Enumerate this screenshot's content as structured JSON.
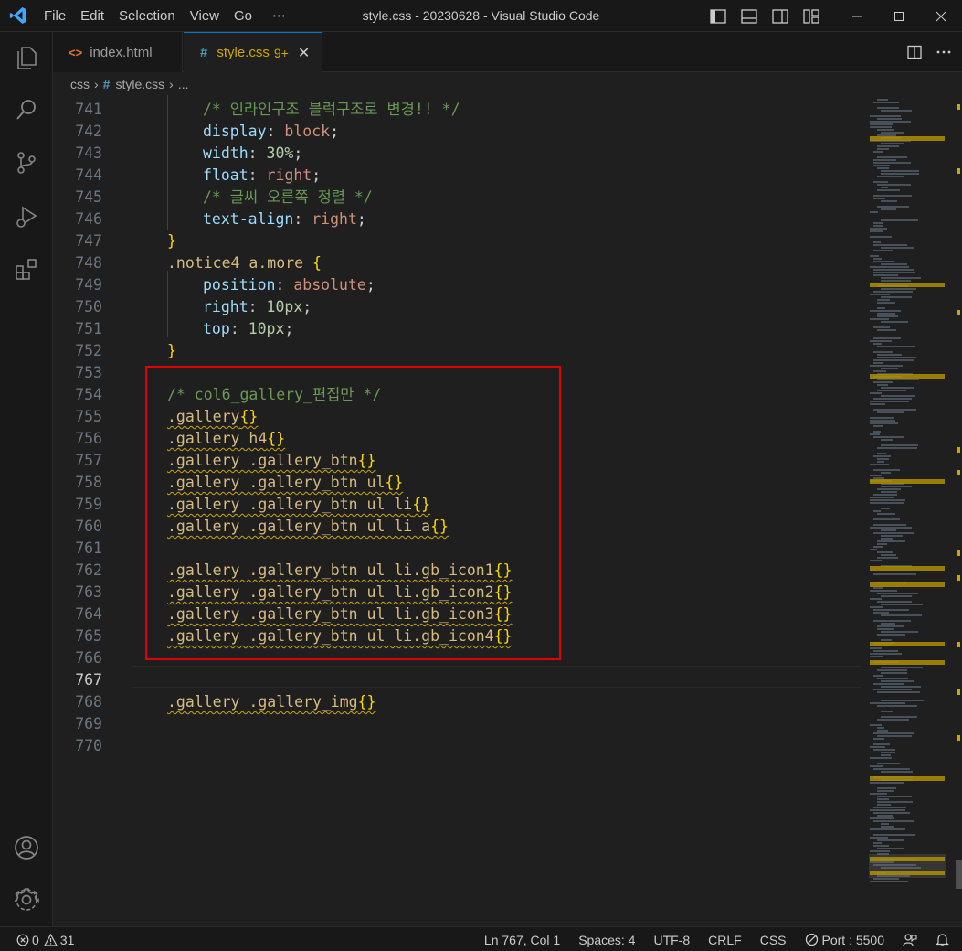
{
  "window": {
    "title": "style.css - 20230628 - Visual Studio Code",
    "menu": [
      "File",
      "Edit",
      "Selection",
      "View",
      "Go",
      "⋯"
    ]
  },
  "tabs": [
    {
      "label": "index.html",
      "icon": "html-file-icon",
      "active": false
    },
    {
      "label": "style.css",
      "icon": "css-file-icon",
      "badge": "9+",
      "active": true
    }
  ],
  "breadcrumb": {
    "folder": "css",
    "file": "style.css",
    "more": "..."
  },
  "editor": {
    "active_line": "767",
    "lines": [
      {
        "n": "741",
        "indent": 2,
        "tokens": [
          {
            "t": "/* 인라인구조 블럭구조로 변경!! */",
            "c": "comment"
          }
        ]
      },
      {
        "n": "742",
        "indent": 2,
        "tokens": [
          {
            "t": "display",
            "c": "prop"
          },
          {
            "t": ": ",
            "c": "punc"
          },
          {
            "t": "block",
            "c": "val"
          },
          {
            "t": ";",
            "c": "punc"
          }
        ]
      },
      {
        "n": "743",
        "indent": 2,
        "tokens": [
          {
            "t": "width",
            "c": "prop"
          },
          {
            "t": ": ",
            "c": "punc"
          },
          {
            "t": "30%",
            "c": "num"
          },
          {
            "t": ";",
            "c": "punc"
          }
        ]
      },
      {
        "n": "744",
        "indent": 2,
        "tokens": [
          {
            "t": "float",
            "c": "prop"
          },
          {
            "t": ": ",
            "c": "punc"
          },
          {
            "t": "right",
            "c": "val"
          },
          {
            "t": ";",
            "c": "punc"
          }
        ]
      },
      {
        "n": "745",
        "indent": 2,
        "tokens": [
          {
            "t": "/* 글씨 오른쪽 정렬 */",
            "c": "comment"
          }
        ]
      },
      {
        "n": "746",
        "indent": 2,
        "tokens": [
          {
            "t": "text-align",
            "c": "prop"
          },
          {
            "t": ": ",
            "c": "punc"
          },
          {
            "t": "right",
            "c": "val"
          },
          {
            "t": ";",
            "c": "punc"
          }
        ]
      },
      {
        "n": "747",
        "indent": 1,
        "tokens": [
          {
            "t": "}",
            "c": "brace"
          }
        ]
      },
      {
        "n": "748",
        "indent": 1,
        "tokens": [
          {
            "t": ".notice4 a.more ",
            "c": "sel"
          },
          {
            "t": "{",
            "c": "brace"
          }
        ]
      },
      {
        "n": "749",
        "indent": 2,
        "tokens": [
          {
            "t": "position",
            "c": "prop"
          },
          {
            "t": ": ",
            "c": "punc"
          },
          {
            "t": "absolute",
            "c": "val"
          },
          {
            "t": ";",
            "c": "punc"
          }
        ]
      },
      {
        "n": "750",
        "indent": 2,
        "tokens": [
          {
            "t": "right",
            "c": "prop"
          },
          {
            "t": ": ",
            "c": "punc"
          },
          {
            "t": "10px",
            "c": "num"
          },
          {
            "t": ";",
            "c": "punc"
          }
        ]
      },
      {
        "n": "751",
        "indent": 2,
        "tokens": [
          {
            "t": "top",
            "c": "prop"
          },
          {
            "t": ": ",
            "c": "punc"
          },
          {
            "t": "10px",
            "c": "num"
          },
          {
            "t": ";",
            "c": "punc"
          }
        ]
      },
      {
        "n": "752",
        "indent": 1,
        "tokens": [
          {
            "t": "}",
            "c": "brace"
          }
        ]
      },
      {
        "n": "753",
        "indent": 0,
        "tokens": []
      },
      {
        "n": "754",
        "indent": 1,
        "tokens": [
          {
            "t": "/* col6_gallery_편집만 */",
            "c": "comment"
          }
        ]
      },
      {
        "n": "755",
        "indent": 1,
        "tokens": [
          {
            "t": ".gallery",
            "c": "sel",
            "s": true
          },
          {
            "t": "{}",
            "c": "brace",
            "s": true
          }
        ]
      },
      {
        "n": "756",
        "indent": 1,
        "tokens": [
          {
            "t": ".gallery h4",
            "c": "sel",
            "s": true
          },
          {
            "t": "{}",
            "c": "brace",
            "s": true
          }
        ]
      },
      {
        "n": "757",
        "indent": 1,
        "tokens": [
          {
            "t": ".gallery .gallery_btn",
            "c": "sel",
            "s": true
          },
          {
            "t": "{}",
            "c": "brace",
            "s": true
          }
        ]
      },
      {
        "n": "758",
        "indent": 1,
        "tokens": [
          {
            "t": ".gallery .gallery_btn ul",
            "c": "sel",
            "s": true
          },
          {
            "t": "{}",
            "c": "brace",
            "s": true
          }
        ]
      },
      {
        "n": "759",
        "indent": 1,
        "tokens": [
          {
            "t": ".gallery .gallery_btn ul li",
            "c": "sel",
            "s": true
          },
          {
            "t": "{}",
            "c": "brace",
            "s": true
          }
        ]
      },
      {
        "n": "760",
        "indent": 1,
        "tokens": [
          {
            "t": ".gallery .gallery_btn ul li a",
            "c": "sel",
            "s": true
          },
          {
            "t": "{}",
            "c": "brace",
            "s": true
          }
        ]
      },
      {
        "n": "761",
        "indent": 0,
        "tokens": []
      },
      {
        "n": "762",
        "indent": 1,
        "tokens": [
          {
            "t": ".gallery .gallery_btn ul li.gb_icon1",
            "c": "sel",
            "s": true
          },
          {
            "t": "{}",
            "c": "brace",
            "s": true
          }
        ]
      },
      {
        "n": "763",
        "indent": 1,
        "tokens": [
          {
            "t": ".gallery .gallery_btn ul li.gb_icon2",
            "c": "sel",
            "s": true
          },
          {
            "t": "{}",
            "c": "brace",
            "s": true
          }
        ]
      },
      {
        "n": "764",
        "indent": 1,
        "tokens": [
          {
            "t": ".gallery .gallery_btn ul li.gb_icon3",
            "c": "sel",
            "s": true
          },
          {
            "t": "{}",
            "c": "brace",
            "s": true
          }
        ]
      },
      {
        "n": "765",
        "indent": 1,
        "tokens": [
          {
            "t": ".gallery .gallery_btn ul li.gb_icon4",
            "c": "sel",
            "s": true
          },
          {
            "t": "{}",
            "c": "brace",
            "s": true
          }
        ]
      },
      {
        "n": "766",
        "indent": 0,
        "tokens": []
      },
      {
        "n": "767",
        "indent": 0,
        "tokens": []
      },
      {
        "n": "768",
        "indent": 1,
        "tokens": [
          {
            "t": ".gallery .gallery_img",
            "c": "sel",
            "s": true
          },
          {
            "t": "{}",
            "c": "brace",
            "s": true
          }
        ]
      },
      {
        "n": "769",
        "indent": 0,
        "tokens": []
      },
      {
        "n": "770",
        "indent": 0,
        "tokens": []
      }
    ]
  },
  "status": {
    "errors": "0",
    "warnings": "31",
    "position": "Ln 767, Col 1",
    "spaces": "Spaces: 4",
    "encoding": "UTF-8",
    "eol": "CRLF",
    "language": "CSS",
    "port": "Port : 5500"
  },
  "colors": {
    "accent": "#0078d4",
    "warning": "#cca700",
    "highlight_box": "#e00000"
  }
}
